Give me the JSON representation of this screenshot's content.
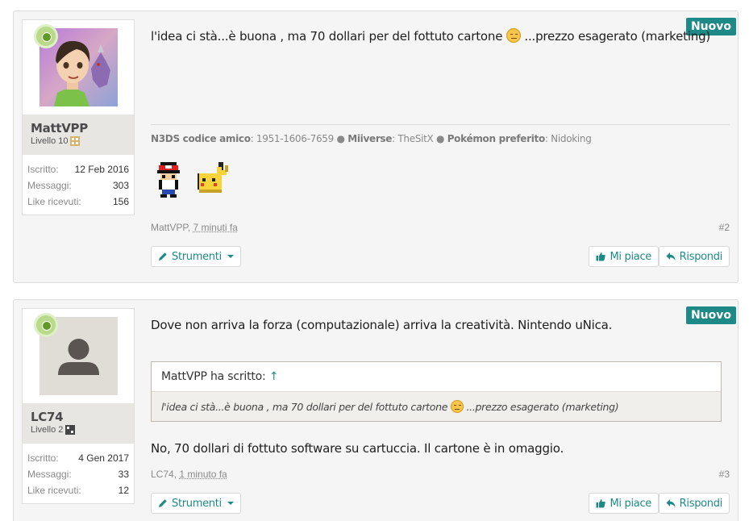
{
  "posts": [
    {
      "user": {
        "name": "MattVPP",
        "level": "Livello 10"
      },
      "stats": [
        {
          "label": "Iscritto:",
          "value": "12 Feb 2016"
        },
        {
          "label": "Messaggi:",
          "value": "303"
        },
        {
          "label": "Like ricevuti:",
          "value": "156"
        }
      ],
      "badge": "Nuovo",
      "message_part1": "l'idea ci stà...è buona , ma 70 dollari per del fottuto cartone",
      "message_part2": "...prezzo esagerato (marketing)",
      "signature": {
        "n3ds_label": "N3DS codice amico",
        "n3ds_value": ": 1951-1606-7659",
        "miiverse_label": "Miiverse",
        "miiverse_value": ": TheSitX",
        "pokemon_label": "Pokémon preferito",
        "pokemon_value": ": Nidoking"
      },
      "author": "MattVPP",
      "time": "7 minuti fa",
      "number": "#2",
      "tools_label": "Strumenti",
      "like_label": "Mi piace",
      "reply_label": "Rispondi"
    },
    {
      "user": {
        "name": "LC74",
        "level": "Livello 2"
      },
      "stats": [
        {
          "label": "Iscritto:",
          "value": "4 Gen 2017"
        },
        {
          "label": "Messaggi:",
          "value": "33"
        },
        {
          "label": "Like ricevuti:",
          "value": "12"
        }
      ],
      "badge": "Nuovo",
      "message": "Dove non arriva la forza (computazionale) arriva la creatività. Nintendo uNica.",
      "quote": {
        "author_text": "MattVPP ha scritto:",
        "arrow": "↑",
        "body_part1": "l'idea ci stà...è buona , ma 70 dollari per del fottuto cartone",
        "body_part2": "...prezzo esagerato (marketing)"
      },
      "reply_text": "No, 70 dollari di fottuto software su cartuccia. Il cartone è in omaggio.",
      "author": "LC74",
      "time": "1 minuto fa",
      "number": "#3",
      "tools_label": "Strumenti",
      "like_label": "Mi piace",
      "reply_label": "Rispondi"
    }
  ],
  "colors": {
    "accent": "#1e8a88",
    "badge": "#1e8a88",
    "online": "#5f9a27"
  }
}
